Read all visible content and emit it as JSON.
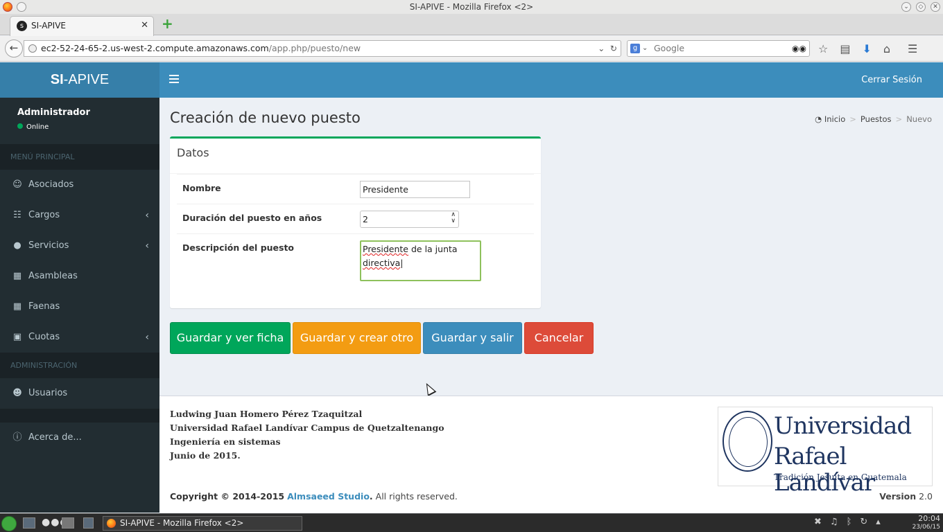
{
  "window": {
    "title": "SI-APIVE - Mozilla Firefox <2>",
    "tab_title": "SI-APIVE",
    "url_host": "ec2-52-24-65-2.us-west-2.compute.amazonaws.com",
    "url_path": "/app.php/puesto/new",
    "search_placeholder": "Google"
  },
  "brand": {
    "bold": "SI",
    "rest": "-APIVE"
  },
  "user": {
    "name": "Administrador",
    "status": "Online"
  },
  "sidebar": {
    "header_main": "MENÚ PRINCIPAL",
    "main_items": [
      {
        "label": "Asociados",
        "icon": "users-icon"
      },
      {
        "label": "Cargos",
        "icon": "sitemap-icon"
      },
      {
        "label": "Servicios",
        "icon": "tint-icon"
      },
      {
        "label": "Asambleas",
        "icon": "calendar-icon"
      },
      {
        "label": "Faenas",
        "icon": "calendar-icon"
      },
      {
        "label": "Cuotas",
        "icon": "money-icon"
      }
    ],
    "header_admin": "ADMINISTRACIÓN",
    "admin_items": [
      {
        "label": "Usuarios",
        "icon": "user-icon"
      }
    ],
    "about": "Acerca de..."
  },
  "topnav": {
    "logout": "Cerrar Sesión"
  },
  "page": {
    "title": "Creación de nuevo puesto",
    "breadcrumb": {
      "home": "Inicio",
      "section": "Puestos",
      "current": "Nuevo"
    }
  },
  "form": {
    "box_title": "Datos",
    "nombre_label": "Nombre",
    "nombre_value": "Presidente",
    "duracion_label": "Duración del puesto en años",
    "duracion_value": "2",
    "descripcion_label": "Descripción del puesto",
    "descripcion_word1": "Presidente",
    "descripcion_rest1": " de la junta",
    "descripcion_word2": "directiva"
  },
  "buttons": {
    "save_view": "Guardar y ver ficha",
    "save_new": "Guardar y crear otro",
    "save_exit": "Guardar y salir",
    "cancel": "Cancelar"
  },
  "footer": {
    "lines": [
      "Ludwing Juan Homero Pérez Tzaquitzal",
      "Universidad Rafael Landívar Campus de Quetzaltenango",
      "Ingeniería en sistemas",
      "Junio de 2015."
    ],
    "logo_line1": "Universidad",
    "logo_line2": "Rafael Landívar",
    "logo_line3": "Tradición Jesuita en Guatemala",
    "copyright_prefix": "Copyright © 2014-2015",
    "studio": "Almsaeed Studio",
    "rights": "All rights reserved.",
    "version_label": "Version",
    "version_value": "2.0"
  },
  "taskbar": {
    "task_label": "SI-APIVE - Mozilla Firefox <2>",
    "time": "20:04",
    "date": "23/06/15"
  },
  "colors": {
    "primary": "#3c8dbc",
    "success": "#00a65a",
    "warning": "#f39c12",
    "danger": "#dd4b39",
    "sidebar": "#222d32"
  }
}
